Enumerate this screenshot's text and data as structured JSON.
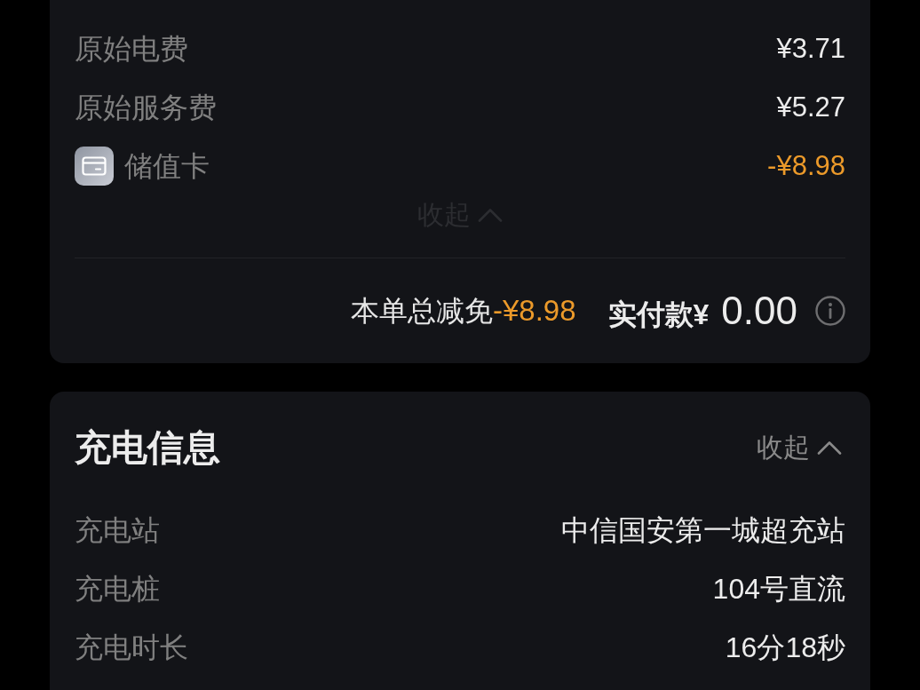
{
  "fee_details": {
    "items": [
      {
        "kind": "fee",
        "label": "原始电费",
        "amount": "¥3.71",
        "discount": false
      },
      {
        "kind": "fee",
        "label": "原始服务费",
        "amount": "¥5.27",
        "discount": false
      },
      {
        "kind": "payment",
        "label": "储值卡",
        "amount": "-¥8.98",
        "discount": true
      }
    ],
    "collapse_toggle": {
      "label": "收起",
      "dimmed": true
    },
    "summary": {
      "discount_label": "本单总减免",
      "discount_amount": "-¥8.98",
      "paid_label": "实付款",
      "paid_currency": "¥",
      "paid_amount": "0.00"
    }
  },
  "charging_info": {
    "title": "充电信息",
    "collapse_toggle": {
      "label": "收起",
      "dimmed": false
    },
    "rows": [
      {
        "label": "充电站",
        "value": "中信国安第一城超充站"
      },
      {
        "label": "充电桩",
        "value": "104号直流"
      },
      {
        "label": "充电时长",
        "value": "16分18秒"
      }
    ]
  }
}
